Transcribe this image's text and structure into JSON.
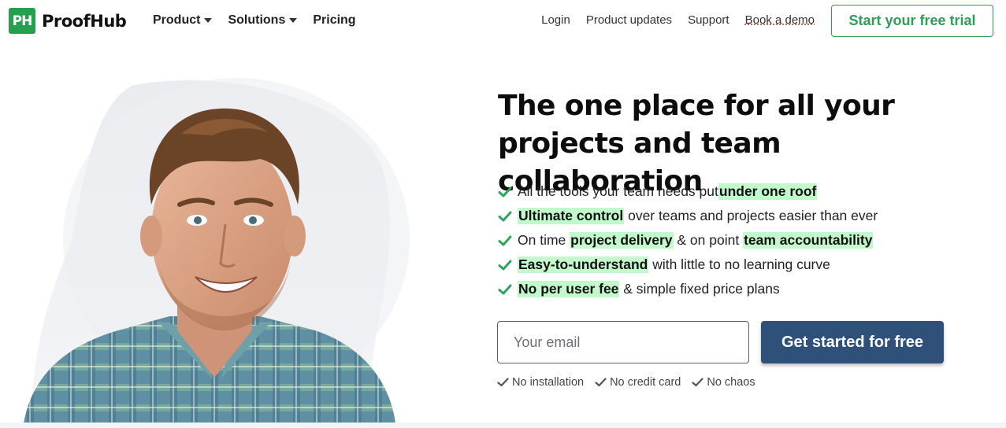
{
  "colors": {
    "brand_green": "#24a04e",
    "cta_blue": "#2f5179",
    "highlight": "#c3f7cc",
    "check_green": "#2aa75b"
  },
  "brand": {
    "logo_mark": "PH",
    "name": "ProofHub"
  },
  "nav": {
    "left": [
      {
        "label": "Product",
        "has_dropdown": true
      },
      {
        "label": "Solutions",
        "has_dropdown": true
      },
      {
        "label": "Pricing",
        "has_dropdown": false
      }
    ],
    "right": [
      "Login",
      "Product updates",
      "Support",
      "Book a demo"
    ],
    "trial_button": "Start your free trial"
  },
  "hero": {
    "headline_line1": "The one place for all your",
    "headline_line2": "projects and team collaboration",
    "features": [
      {
        "pre": "All the tools your team needs put ",
        "hl1": "under one roof",
        "mid": "",
        "hl2": "",
        "post": ""
      },
      {
        "pre": "",
        "hl1": "Ultimate control",
        "mid": "",
        "hl2": "",
        "post": " over teams and projects easier than ever"
      },
      {
        "pre": "On time ",
        "hl1": "project delivery",
        "mid": " & on point ",
        "hl2": "team accountability",
        "post": ""
      },
      {
        "pre": "",
        "hl1": "Easy-to-understand",
        "mid": "",
        "hl2": "",
        "post": " with little to no learning curve"
      },
      {
        "pre": "",
        "hl1": "No per user fee",
        "mid": "",
        "hl2": "",
        "post": " & simple fixed price plans"
      }
    ],
    "email_placeholder": "Your email",
    "email_value": "",
    "cta_label": "Get started for free",
    "notes": [
      "No installation",
      "No credit card",
      "No chaos"
    ]
  }
}
